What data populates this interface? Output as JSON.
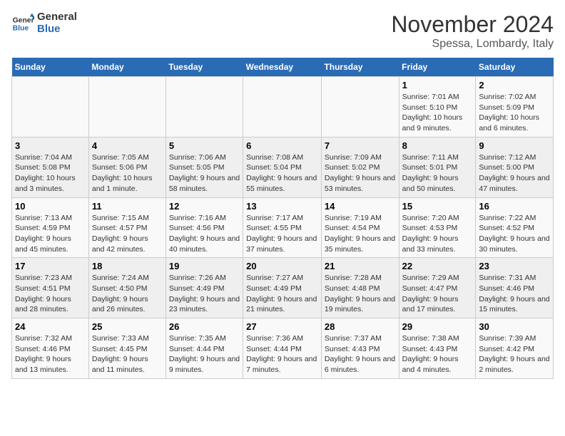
{
  "logo": {
    "line1": "General",
    "line2": "Blue"
  },
  "title": "November 2024",
  "location": "Spessa, Lombardy, Italy",
  "weekdays": [
    "Sunday",
    "Monday",
    "Tuesday",
    "Wednesday",
    "Thursday",
    "Friday",
    "Saturday"
  ],
  "weeks": [
    [
      {
        "day": "",
        "info": ""
      },
      {
        "day": "",
        "info": ""
      },
      {
        "day": "",
        "info": ""
      },
      {
        "day": "",
        "info": ""
      },
      {
        "day": "",
        "info": ""
      },
      {
        "day": "1",
        "info": "Sunrise: 7:01 AM\nSunset: 5:10 PM\nDaylight: 10 hours and 9 minutes."
      },
      {
        "day": "2",
        "info": "Sunrise: 7:02 AM\nSunset: 5:09 PM\nDaylight: 10 hours and 6 minutes."
      }
    ],
    [
      {
        "day": "3",
        "info": "Sunrise: 7:04 AM\nSunset: 5:08 PM\nDaylight: 10 hours and 3 minutes."
      },
      {
        "day": "4",
        "info": "Sunrise: 7:05 AM\nSunset: 5:06 PM\nDaylight: 10 hours and 1 minute."
      },
      {
        "day": "5",
        "info": "Sunrise: 7:06 AM\nSunset: 5:05 PM\nDaylight: 9 hours and 58 minutes."
      },
      {
        "day": "6",
        "info": "Sunrise: 7:08 AM\nSunset: 5:04 PM\nDaylight: 9 hours and 55 minutes."
      },
      {
        "day": "7",
        "info": "Sunrise: 7:09 AM\nSunset: 5:02 PM\nDaylight: 9 hours and 53 minutes."
      },
      {
        "day": "8",
        "info": "Sunrise: 7:11 AM\nSunset: 5:01 PM\nDaylight: 9 hours and 50 minutes."
      },
      {
        "day": "9",
        "info": "Sunrise: 7:12 AM\nSunset: 5:00 PM\nDaylight: 9 hours and 47 minutes."
      }
    ],
    [
      {
        "day": "10",
        "info": "Sunrise: 7:13 AM\nSunset: 4:59 PM\nDaylight: 9 hours and 45 minutes."
      },
      {
        "day": "11",
        "info": "Sunrise: 7:15 AM\nSunset: 4:57 PM\nDaylight: 9 hours and 42 minutes."
      },
      {
        "day": "12",
        "info": "Sunrise: 7:16 AM\nSunset: 4:56 PM\nDaylight: 9 hours and 40 minutes."
      },
      {
        "day": "13",
        "info": "Sunrise: 7:17 AM\nSunset: 4:55 PM\nDaylight: 9 hours and 37 minutes."
      },
      {
        "day": "14",
        "info": "Sunrise: 7:19 AM\nSunset: 4:54 PM\nDaylight: 9 hours and 35 minutes."
      },
      {
        "day": "15",
        "info": "Sunrise: 7:20 AM\nSunset: 4:53 PM\nDaylight: 9 hours and 33 minutes."
      },
      {
        "day": "16",
        "info": "Sunrise: 7:22 AM\nSunset: 4:52 PM\nDaylight: 9 hours and 30 minutes."
      }
    ],
    [
      {
        "day": "17",
        "info": "Sunrise: 7:23 AM\nSunset: 4:51 PM\nDaylight: 9 hours and 28 minutes."
      },
      {
        "day": "18",
        "info": "Sunrise: 7:24 AM\nSunset: 4:50 PM\nDaylight: 9 hours and 26 minutes."
      },
      {
        "day": "19",
        "info": "Sunrise: 7:26 AM\nSunset: 4:49 PM\nDaylight: 9 hours and 23 minutes."
      },
      {
        "day": "20",
        "info": "Sunrise: 7:27 AM\nSunset: 4:49 PM\nDaylight: 9 hours and 21 minutes."
      },
      {
        "day": "21",
        "info": "Sunrise: 7:28 AM\nSunset: 4:48 PM\nDaylight: 9 hours and 19 minutes."
      },
      {
        "day": "22",
        "info": "Sunrise: 7:29 AM\nSunset: 4:47 PM\nDaylight: 9 hours and 17 minutes."
      },
      {
        "day": "23",
        "info": "Sunrise: 7:31 AM\nSunset: 4:46 PM\nDaylight: 9 hours and 15 minutes."
      }
    ],
    [
      {
        "day": "24",
        "info": "Sunrise: 7:32 AM\nSunset: 4:46 PM\nDaylight: 9 hours and 13 minutes."
      },
      {
        "day": "25",
        "info": "Sunrise: 7:33 AM\nSunset: 4:45 PM\nDaylight: 9 hours and 11 minutes."
      },
      {
        "day": "26",
        "info": "Sunrise: 7:35 AM\nSunset: 4:44 PM\nDaylight: 9 hours and 9 minutes."
      },
      {
        "day": "27",
        "info": "Sunrise: 7:36 AM\nSunset: 4:44 PM\nDaylight: 9 hours and 7 minutes."
      },
      {
        "day": "28",
        "info": "Sunrise: 7:37 AM\nSunset: 4:43 PM\nDaylight: 9 hours and 6 minutes."
      },
      {
        "day": "29",
        "info": "Sunrise: 7:38 AM\nSunset: 4:43 PM\nDaylight: 9 hours and 4 minutes."
      },
      {
        "day": "30",
        "info": "Sunrise: 7:39 AM\nSunset: 4:42 PM\nDaylight: 9 hours and 2 minutes."
      }
    ]
  ]
}
